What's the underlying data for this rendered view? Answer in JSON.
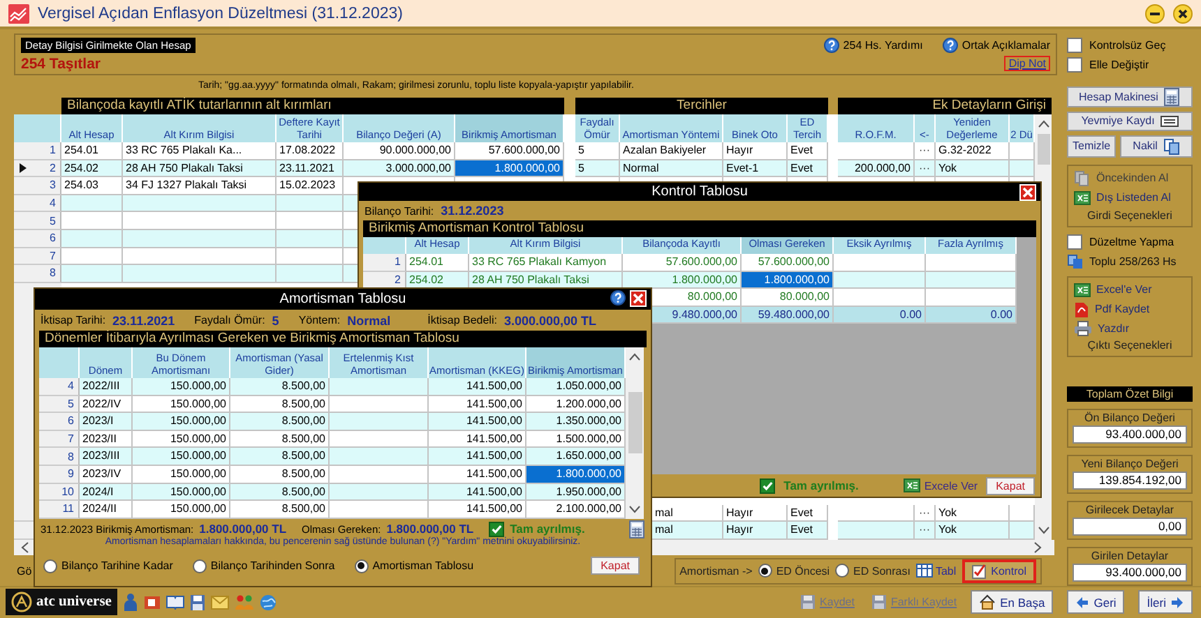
{
  "window": {
    "title": "Vergisel Açıdan Enflasyon Düzeltmesi (31.12.2023)"
  },
  "account_panel": {
    "label": "Detay Bilgisi Girilmekte Olan Hesap",
    "account": "254 Taşıtlar",
    "links": [
      "254 Hs. Yardımı",
      "Ortak Açıklamalar"
    ],
    "footnote": "Dip Not"
  },
  "hint": "Tarih; \"gg.aa.yyyy\"  formatında olmalı, Rakam; girilmesi zorunlu, toplu liste kopyala-yapıştır yapılabilir.",
  "main_grid": {
    "sections": [
      {
        "title": "Bilançoda kayıtlı ATİK tutarlarının alt kırımları",
        "columns": [
          {
            "label": "Alt Hesap",
            "focused": false
          },
          {
            "label": "Alt Kırım Bilgisi",
            "focused": false
          },
          {
            "label": "Deftere Kayıt Tarihi",
            "focused": false
          },
          {
            "label": "Bilanço Değeri (A)",
            "focused": false
          },
          {
            "label": "Birikmiş Amortisman",
            "focused": true
          }
        ]
      },
      {
        "title": "Tercihler",
        "columns": [
          {
            "label": "Faydalı Ömür",
            "focused": false
          },
          {
            "label": "Amortisman Yöntemi",
            "focused": false
          },
          {
            "label": "Binek Oto",
            "focused": false
          },
          {
            "label": "ED Tercih",
            "focused": false
          }
        ]
      },
      {
        "title": "Ek Detayların Girişi",
        "columns": [
          {
            "label": "R.O.F.M.",
            "focused": false
          },
          {
            "label": "<-",
            "focused": false
          },
          {
            "label": "Yeniden Değerleme",
            "focused": false
          },
          {
            "label": "2 Dü",
            "focused": false
          }
        ]
      }
    ],
    "rows": [
      {
        "number": "1",
        "selected": false,
        "cells": [
          "254.01",
          "33 RC 765 Plakalı Ka...",
          "17.08.2022",
          "90.000.000,00",
          "57.600.000,00",
          "5",
          "Azalan Bakiyeler",
          "Hayır",
          "Evet",
          null,
          "···",
          "G.32-2022"
        ]
      },
      {
        "number": "2",
        "selected": true,
        "cells": [
          "254.02",
          "28 AH 750 Plakalı Taksi",
          "23.11.2021",
          "3.000.000,00",
          "1.800.000,00",
          "5",
          "Normal",
          "Evet-1",
          "Evet",
          "200.000,00",
          "···",
          "Yok"
        ]
      },
      {
        "number": "3",
        "selected": false,
        "cells": [
          "254.03",
          "34 FJ 1327 Plakalı Taksi",
          "15.02.2023"
        ]
      },
      {
        "number": "4",
        "selected": false
      },
      {
        "number": "5",
        "selected": false
      },
      {
        "number": "6",
        "selected": false
      },
      {
        "number": "7",
        "selected": false
      },
      {
        "number": "8",
        "selected": false
      }
    ],
    "tail_rows": [
      {
        "cells": [
          null,
          null,
          null,
          null,
          null,
          null,
          "mal",
          "Hayır",
          "Evet",
          null,
          "···",
          "Yok"
        ]
      },
      {
        "cells": [
          null,
          null,
          null,
          null,
          null,
          null,
          "mal",
          "Hayır",
          "Evet",
          null,
          "···",
          "Yok"
        ]
      }
    ],
    "side_label": "Gö"
  },
  "method_bar": {
    "label": "Amortisman ->",
    "options": [
      {
        "label": "ED Öncesi",
        "selected": true
      },
      {
        "label": "ED Sonrası",
        "selected": false
      }
    ],
    "table_button": "Tabl",
    "check_button": "Kontrol"
  },
  "sidebar": {
    "checkboxes": [
      {
        "label": "Kontrolsüz Geç",
        "checked": false
      },
      {
        "label": "Elle Değiştir",
        "checked": false
      }
    ],
    "tools": [
      "Hesap Makinesi",
      "Yevmiye Kaydı"
    ],
    "small_tools": [
      "Temizle",
      "Nakil"
    ],
    "input_group": {
      "items": [
        {
          "label": "Öncekinden Al",
          "disabled": true
        },
        {
          "label": "Dış Listeden Al",
          "disabled": false
        }
      ],
      "title": "Girdi Seçenekleri"
    },
    "no_adjust": {
      "label": "Düzeltme Yapma",
      "checked": false
    },
    "bulk": "Toplu 258/263 Hs",
    "output_group": {
      "items": [
        "Excel'e Ver",
        "Pdf Kaydet",
        "Yazdır"
      ],
      "title": "Çıktı Seçenekleri"
    },
    "summary": {
      "title": "Toplam Özet Bilgi",
      "fields": [
        {
          "label": "Ön Bilanço Değeri",
          "value": "93.400.000,00"
        },
        {
          "label": "Yeni Bilanço Değeri",
          "value": "139.854.192,00"
        },
        {
          "label": "Girilecek Detaylar",
          "value": "0,00"
        },
        {
          "label": "Girilen Detaylar",
          "value": "93.400.000,00"
        }
      ]
    }
  },
  "toolbar": {
    "logo": "atc universe",
    "actions": [
      {
        "label": "Kaydet",
        "disabled": true
      },
      {
        "label": "Farklı Kaydet",
        "disabled": true
      }
    ],
    "nav": [
      "En Başa",
      "Geri",
      "İleri"
    ]
  },
  "control_dialog": {
    "title": "Kontrol Tablosu",
    "date_label": "Bilanço Tarihi:",
    "date": "31.12.2023",
    "subtitle": "Birikmiş Amortisman Kontrol Tablosu",
    "columns": [
      {
        "label": "Alt Hesap",
        "focused": false
      },
      {
        "label": "Alt Kırım Bilgisi",
        "focused": false
      },
      {
        "label": "Bilançoda Kayıtlı",
        "focused": false
      },
      {
        "label": "Olması Gereken",
        "focused": true
      },
      {
        "label": "Eksik Ayrılmış",
        "focused": false
      },
      {
        "label": "Fazla Ayrılmış",
        "focused": false
      }
    ],
    "rows": [
      {
        "kind": "item",
        "number": "1",
        "selected": false,
        "cells": [
          "254.01",
          "33 RC 765 Plakalı Kamyon",
          "57.600.000,00",
          "57.600.000,00"
        ]
      },
      {
        "kind": "item",
        "number": "2",
        "selected": true,
        "cells": [
          "254.02",
          "28 AH 750 Plakalı Taksi",
          "1.800.000,00",
          "1.800.000,00"
        ]
      },
      {
        "kind": "item",
        "selected": false,
        "cells": [
          null,
          null,
          "80.000,00",
          "80.000,00"
        ]
      },
      {
        "kind": "total",
        "selected": false,
        "cells": [
          null,
          null,
          "9.480.000,00",
          "59.480.000,00",
          "0.00",
          "0.00"
        ]
      }
    ],
    "status": {
      "label": "Tam ayrılmış.",
      "checked": true
    },
    "export_button": "Excele Ver",
    "close_button": "Kapat"
  },
  "amortization_dialog": {
    "title": "Amortisman Tablosu",
    "info": [
      {
        "label": "İktisap Tarihi:",
        "value": "23.11.2021"
      },
      {
        "label": "Faydalı Ömür:",
        "value": "5"
      },
      {
        "label": "Yöntem:",
        "value": "Normal"
      }
    ],
    "cost": {
      "label": "İktisap Bedeli:",
      "value": "3.000.000,00 TL"
    },
    "subtitle": "Dönemler İtibarıyla Ayrılması Gereken ve Birikmiş Amortisman Tablosu",
    "columns": [
      {
        "label": "Dönem",
        "focused": false
      },
      {
        "label": "Bu Dönem Amortismanı",
        "focused": false
      },
      {
        "label": "Amortisman (Yasal Gider)",
        "focused": false
      },
      {
        "label": "Ertelenmiş Kıst Amortisman",
        "focused": false
      },
      {
        "label": "Amortisman (KKEG)",
        "focused": false
      },
      {
        "label": "Birikmiş Amortisman",
        "focused": true
      }
    ],
    "rows": [
      {
        "number": "4",
        "selected": false,
        "cells": [
          "2022/III",
          "150.000,00",
          "8.500,00",
          null,
          "141.500,00",
          "1.050.000,00"
        ]
      },
      {
        "number": "5",
        "selected": false,
        "cells": [
          "2022/IV",
          "150.000,00",
          "8.500,00",
          null,
          "141.500,00",
          "1.200.000,00"
        ]
      },
      {
        "number": "6",
        "selected": false,
        "cells": [
          "2023/I",
          "150.000,00",
          "8.500,00",
          null,
          "141.500,00",
          "1.350.000,00"
        ]
      },
      {
        "number": "7",
        "selected": false,
        "cells": [
          "2023/II",
          "150.000,00",
          "8.500,00",
          null,
          "141.500,00",
          "1.500.000,00"
        ]
      },
      {
        "number": "8",
        "selected": false,
        "cells": [
          "2023/III",
          "150.000,00",
          "8.500,00",
          null,
          "141.500,00",
          "1.650.000,00"
        ]
      },
      {
        "number": "9",
        "selected": true,
        "cells": [
          "2023/IV",
          "150.000,00",
          "8.500,00",
          null,
          "141.500,00",
          "1.800.000,00"
        ]
      },
      {
        "number": "10",
        "selected": false,
        "cells": [
          "2024/I",
          "150.000,00",
          "8.500,00",
          null,
          "141.500,00",
          "1.950.000,00"
        ]
      },
      {
        "number": "11",
        "selected": false,
        "cells": [
          "2024/II",
          "150.000,00",
          "8.500,00",
          null,
          "141.500,00",
          "2.100.000,00"
        ]
      }
    ],
    "summary": [
      {
        "label": "31.12.2023 Birikmiş Amortisman:",
        "value": "1.800.000,00 TL"
      },
      {
        "label": "Olması Gereken:",
        "value": "1.800.000,00 TL"
      }
    ],
    "status": {
      "label": "Tam ayrılmış.",
      "checked": true
    },
    "note": "Amortisman hesaplamaları hakkında, bu pencerenin sağ üstünde bulunan (?) \"Yardım\" metnini okuyabilirsiniz.",
    "views": [
      {
        "label": "Bilanço Tarihine Kadar",
        "selected": false
      },
      {
        "label": "Bilanço Tarihinden Sonra",
        "selected": false
      },
      {
        "label": "Amortisman Tablosu",
        "selected": true
      }
    ],
    "close_button": "Kapat"
  }
}
